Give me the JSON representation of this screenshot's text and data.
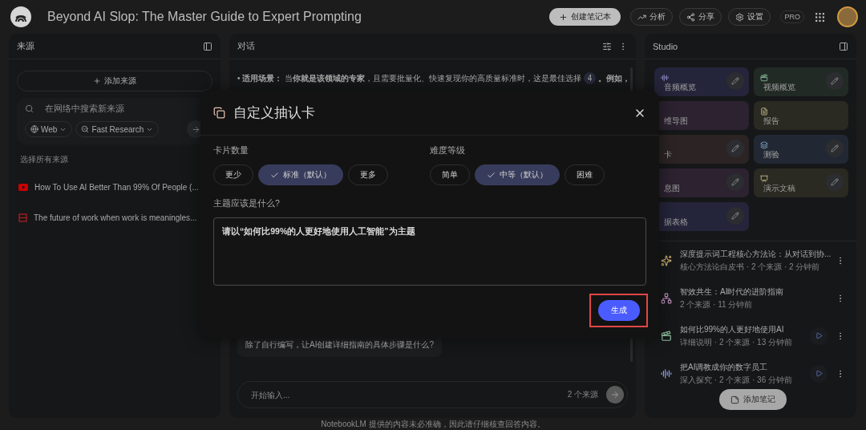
{
  "topbar": {
    "title": "Beyond AI Slop: The Master Guide to Expert Prompting",
    "create_button": "创建笔记本",
    "actions": [
      {
        "kind": "analytics",
        "label": "分析"
      },
      {
        "kind": "share",
        "label": "分享"
      },
      {
        "kind": "settings",
        "label": "设置"
      }
    ],
    "badge": "PRO"
  },
  "sources": {
    "title": "来源",
    "add_button": "添加来源",
    "search": {
      "placeholder": "在网络中搜索新来源"
    },
    "chips": [
      {
        "kind": "web",
        "label": "Web"
      },
      {
        "kind": "research",
        "label": "Fast Research"
      }
    ],
    "select_all": "选择所有来源",
    "items": [
      {
        "kind": "video",
        "title": "How To Use AI Better Than 99% Of People (..."
      },
      {
        "kind": "doc",
        "title": "The future of work when work is meaningles..."
      }
    ]
  },
  "chat": {
    "title": "对话",
    "paragraph": {
      "bullet": "•",
      "label": "适用场景：",
      "text": "当**你就是该领域的专家**，且需要批量化、快速复现你的高质量标准时，这是最佳选择",
      "citation": "4",
      "after": "。例如，"
    },
    "suggestion": "除了自行编写，让AI创建详细指南的具体步骤是什么?",
    "input": {
      "placeholder": "开始输入...",
      "source_count": "2 个来源"
    }
  },
  "footer": "NotebookLM 提供的内容未必准确，因此请仔细核查回答内容。",
  "studio": {
    "title": "Studio",
    "tiles": [
      {
        "kind": "audio",
        "label": "音频概览",
        "color": "#24243a",
        "editable": true
      },
      {
        "kind": "video",
        "label": "视频概览",
        "color": "#222a26",
        "editable": true
      },
      {
        "label": "维导图",
        "color": "#2c2230",
        "editable": false
      },
      {
        "kind": "report",
        "label": "报告",
        "color": "#2a2a22",
        "editable": false
      },
      {
        "label": "卡",
        "color": "#2c2424",
        "editable": true
      },
      {
        "kind": "quiz",
        "label": "测验",
        "color": "#222833",
        "editable": true
      },
      {
        "label": "息图",
        "color": "#2c2230",
        "editable": true
      },
      {
        "kind": "slides",
        "label": "演示文稿",
        "color": "#2a2a22",
        "editable": true
      },
      {
        "label": "据表格",
        "color": "#24243a",
        "editable": true
      }
    ],
    "notes": [
      {
        "kind": "sparkle",
        "title": "深度提示词工程核心方法论：从对话到协...",
        "meta": "核心方法论白皮书 · 2 个来源 · 2 分钟前",
        "playable": false
      },
      {
        "kind": "diagram",
        "title": "智效共生：AI时代的进阶指南",
        "meta": "2 个来源 · 11 分钟前",
        "playable": false
      },
      {
        "kind": "video",
        "title": "如何比99%的人更好地使用AI",
        "meta": "详细说明 · 2 个来源 · 13 分钟前",
        "playable": true
      },
      {
        "kind": "audio",
        "title": "把AI调教成你的数字员工",
        "meta": "深入探究 · 2 个来源 · 36 分钟前",
        "playable": true
      }
    ],
    "add_note": "添加笔记"
  },
  "dialog": {
    "title": "自定义抽认卡",
    "groups": [
      {
        "label": "卡片数量",
        "options": [
          {
            "label": "更少",
            "selected": false
          },
          {
            "label": "标准（默认）",
            "selected": true
          },
          {
            "label": "更多",
            "selected": false
          }
        ]
      },
      {
        "label": "难度等级",
        "options": [
          {
            "label": "简单",
            "selected": false
          },
          {
            "label": "中等（默认）",
            "selected": true
          },
          {
            "label": "困难",
            "selected": false
          }
        ]
      }
    ],
    "topic_label": "主题应该是什么?",
    "topic_value": "请以“如何比99%的人更好地使用人工智能”为主题",
    "generate_button": {
      "label": "生成",
      "highlighted": true
    }
  }
}
